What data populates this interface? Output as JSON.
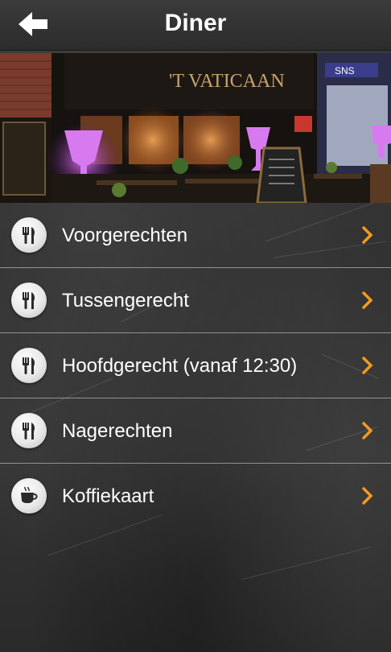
{
  "header": {
    "title": "Diner",
    "back_icon": "arrow-left-icon"
  },
  "hero": {
    "sign_text": "'T VATICAAN",
    "bank_sign": "SNS"
  },
  "menu": {
    "items": [
      {
        "label": "Voorgerechten",
        "icon": "cutlery-icon"
      },
      {
        "label": "Tussengerecht",
        "icon": "cutlery-icon"
      },
      {
        "label": "Hoofdgerecht (vanaf 12:30)",
        "icon": "cutlery-icon"
      },
      {
        "label": "Nagerechten",
        "icon": "cutlery-icon"
      },
      {
        "label": "Koffiekaart",
        "icon": "coffee-cup-icon"
      }
    ]
  },
  "colors": {
    "accent": "#f29a1d",
    "text": "#ffffff",
    "background": "#2f2f2f"
  }
}
